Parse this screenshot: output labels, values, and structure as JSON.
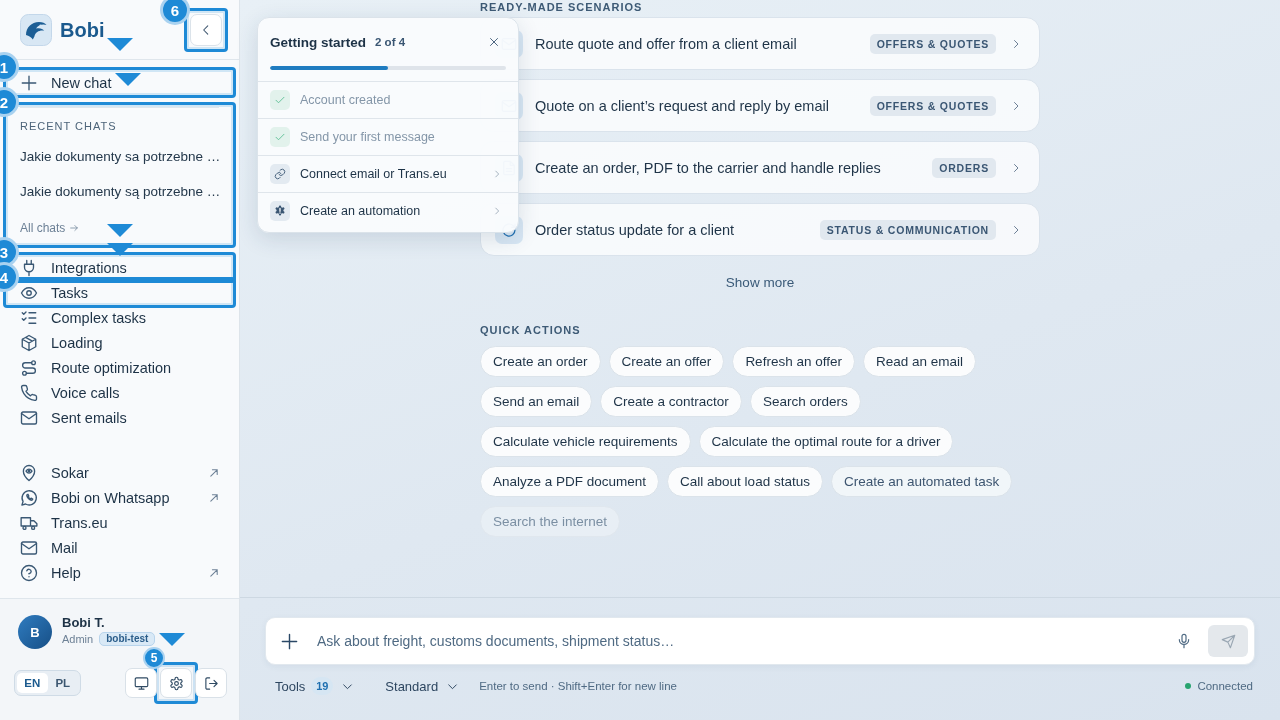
{
  "sidebar": {
    "brand": {
      "name": "Bobi",
      "pointer": true
    },
    "collapse_button": {
      "callout": "6"
    },
    "new_chat": {
      "label": "New chat",
      "callout": "1",
      "pointer": true
    },
    "recent_chats": {
      "title": "RECENT CHATS",
      "callout": "2",
      "items": [
        "Jakie dokumenty sa potrzebne …",
        "Jakie dokumenty są potrzebne …"
      ],
      "all_chats": "All chats",
      "pointer": true
    },
    "nav": [
      {
        "label": "Integrations",
        "callout": "3",
        "pointer": true
      },
      {
        "label": "Tasks",
        "callout": "4",
        "pointer": false
      },
      {
        "label": "Complex tasks",
        "pointer": false
      },
      {
        "label": "Loading",
        "pointer": false
      },
      {
        "label": "Route optimization",
        "pointer": false
      },
      {
        "label": "Voice calls",
        "pointer": false
      },
      {
        "label": "Sent emails",
        "pointer": false
      }
    ],
    "links": [
      {
        "label": "Sokar",
        "external": true
      },
      {
        "label": "Bobi on Whatsapp",
        "external": true
      },
      {
        "label": "Trans.eu",
        "external": false
      },
      {
        "label": "Mail",
        "external": false
      },
      {
        "label": "Help",
        "external": true
      }
    ],
    "user": {
      "initial": "B",
      "name": "Bobi T.",
      "role": "Admin",
      "workspace": "bobi-test",
      "pointer": true
    },
    "languages": [
      {
        "label": "EN",
        "selected": true
      },
      {
        "label": "PL",
        "selected": false
      }
    ],
    "settings_button": {
      "callout": "5"
    }
  },
  "getting_started": {
    "title": "Getting started",
    "progress_text": "2 of 4",
    "level": 0.5,
    "steps": [
      {
        "label": "Account created",
        "done": true
      },
      {
        "label": "Send your first message",
        "done": true
      },
      {
        "label": "Connect email or Trans.eu",
        "done": false
      },
      {
        "label": "Create an automation",
        "done": false
      }
    ]
  },
  "scenarios": {
    "title": "READY-MADE SCENARIOS",
    "items": [
      {
        "label": "Route quote and offer from a client email",
        "tag": "OFFERS & QUOTES"
      },
      {
        "label": "Quote on a client’s request and reply by email",
        "tag": "OFFERS & QUOTES"
      },
      {
        "label": "Create an order, PDF to the carrier and handle replies",
        "tag": "ORDERS"
      },
      {
        "label": "Order status update for a client",
        "tag": "STATUS & COMMUNICATION"
      }
    ],
    "show_more": "Show more"
  },
  "quick_actions": {
    "title": "QUICK ACTIONS",
    "items": [
      {
        "label": "Create an order",
        "kind": "action"
      },
      {
        "label": "Create an offer",
        "kind": "action"
      },
      {
        "label": "Refresh an offer",
        "kind": "action"
      },
      {
        "label": "Read an email",
        "kind": "action"
      },
      {
        "label": "Send an email",
        "kind": "action"
      },
      {
        "label": "Create a contractor",
        "kind": "action"
      },
      {
        "label": "Search orders",
        "kind": "action"
      },
      {
        "label": "Calculate vehicle requirements",
        "kind": "action"
      },
      {
        "label": "Calculate the optimal route for a driver",
        "kind": "action"
      },
      {
        "label": "Analyze a PDF document",
        "kind": "action"
      },
      {
        "label": "Call about load status",
        "kind": "action"
      },
      {
        "label": "Create an automated task",
        "kind": "automation"
      },
      {
        "label": "Search the internet",
        "kind": "web"
      }
    ]
  },
  "composer": {
    "placeholder": "Ask about freight, customs documents, shipment status…",
    "send_button": {
      "disabled": true
    },
    "tools": {
      "label": "Tools",
      "count": "19"
    },
    "mode": "Standard",
    "hint": "Enter to send · Shift+Enter for new line",
    "status": {
      "label": "Connected",
      "connected": true
    }
  }
}
